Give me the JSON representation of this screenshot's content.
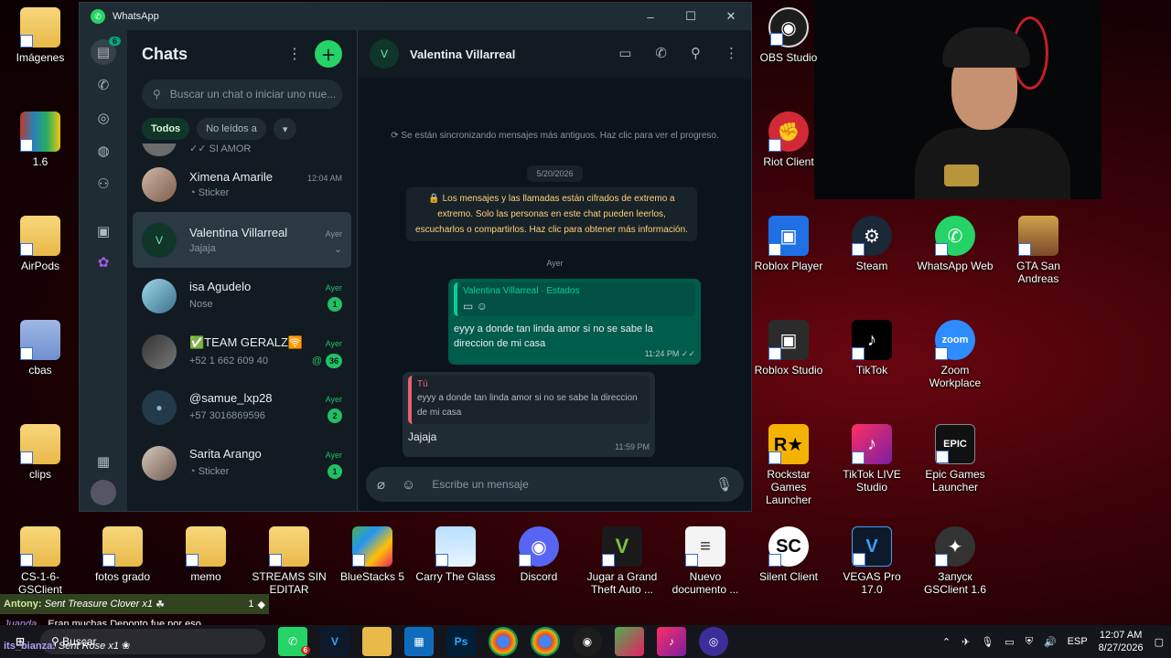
{
  "desktop": {
    "left_icons": [
      {
        "label": "Imágenes"
      },
      {
        "label": "1.6"
      },
      {
        "label": "AirPods"
      },
      {
        "label": "cbas"
      },
      {
        "label": "clips"
      }
    ],
    "right_icons": [
      {
        "label": "OBS Studio"
      },
      {
        "label": "Riot Client"
      },
      {
        "label": "Roblox Player"
      },
      {
        "label": "Steam"
      },
      {
        "label": "WhatsApp Web"
      },
      {
        "label": "GTA San Andreas"
      },
      {
        "label": "Roblox Studio"
      },
      {
        "label": "TikTok"
      },
      {
        "label": "Zoom Workplace"
      },
      {
        "label": "Rockstar Games Launcher"
      },
      {
        "label": "TikTok LIVE Studio"
      },
      {
        "label": "Epic Games Launcher"
      }
    ],
    "bottom_icons": [
      {
        "label": "CS-1-6-GSClient"
      },
      {
        "label": "fotos grado"
      },
      {
        "label": "memo"
      },
      {
        "label": "STREAMS SIN EDITAR"
      },
      {
        "label": "BlueStacks 5"
      },
      {
        "label": "Carry The Glass"
      },
      {
        "label": "Discord"
      },
      {
        "label": "Jugar a Grand Theft Auto ..."
      },
      {
        "label": "Nuevo documento ..."
      },
      {
        "label": "Silent Client"
      },
      {
        "label": "VEGAS Pro 17.0"
      },
      {
        "label": "Запуск GSClient 1.6"
      }
    ]
  },
  "whatsapp": {
    "window_title": "WhatsApp",
    "rail_badge": "6",
    "list_title": "Chats",
    "search_placeholder": "Buscar un chat o iniciar uno nue...",
    "filters": [
      "Todos",
      "No leídos a",
      "▾"
    ],
    "partial_chat_preview": "✓✓ SI AMOR",
    "chats": [
      {
        "name": "Ximena Amarile",
        "time": "12:04 AM",
        "preview": "Sticker",
        "unread": ""
      },
      {
        "name": "Valentina Villarreal",
        "time": "Ayer",
        "preview": "Jajaja",
        "unread": ""
      },
      {
        "name": "isa Agudelo",
        "time": "Ayer",
        "preview": "Nose",
        "unread": "1"
      },
      {
        "name": "✅TEAM GERALZ🛜",
        "time": "Ayer",
        "preview": "+52 1 662 609 40",
        "unread": "36"
      },
      {
        "name": "@samue_lxp28",
        "time": "Ayer",
        "preview": "+57 3016869596",
        "unread": "2"
      },
      {
        "name": "Sarita Arango",
        "time": "Ayer",
        "preview": "Sticker",
        "unread": "1"
      }
    ],
    "conversation": {
      "contact_name": "Valentina Villarreal",
      "avatar_letter": "V",
      "sync_notice": "Se están sincronizando mensajes más antiguos. Haz clic para ver el progreso.",
      "date_1": "5/20/2026",
      "e2e_notice": "Los mensajes y las llamadas están cifrados de extremo a extremo. Solo las personas en este chat pueden leerlos, escucharlos o compartirlos. Haz clic para obtener más información.",
      "date_2": "Ayer",
      "outgoing": {
        "quote_name": "Valentina Villarreal · Estados",
        "text": "eyyy a donde tan linda amor si no se sabe la direccion de mi casa",
        "time": "11:24 PM ✓✓"
      },
      "incoming": {
        "quote_name": "Tú",
        "quote_text": "eyyy a donde tan linda amor si no se sabe la direccion de mi casa",
        "text": "Jajaja",
        "time": "11:59 PM"
      },
      "composer_placeholder": "Escribe un mensaje"
    }
  },
  "stream_overlay": {
    "line1_user": "Antony:",
    "line1_text": "Sent Treasure Clover x1",
    "line1_count": "1",
    "line2_user": "Juanda...",
    "line2_text": "Eran muchas Deponto fue por eso",
    "line3_user": "its_bianza:",
    "line3_text": "Sent Rose x1"
  },
  "taskbar": {
    "search_label": "Buscar",
    "whatsapp_badge": "6",
    "language": "ESP",
    "time": "12:07 AM",
    "date": "8/27/2026"
  },
  "colors": {
    "accent": "#25d366",
    "panel": "#111b21",
    "bubble_out": "#005c4b"
  }
}
